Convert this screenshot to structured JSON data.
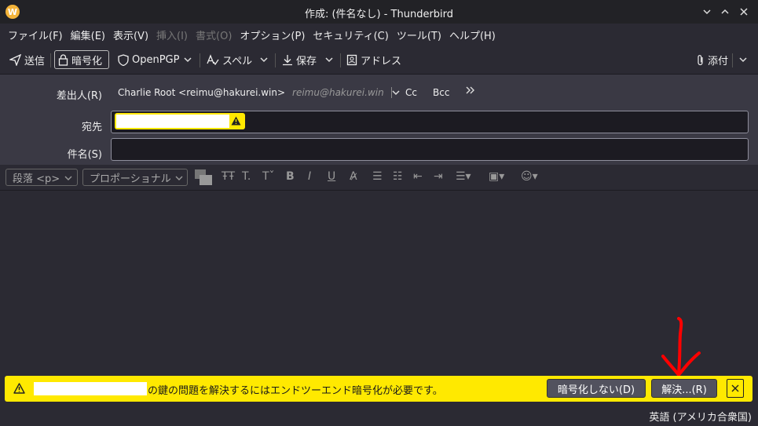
{
  "window": {
    "title": "作成: (件名なし) - Thunderbird",
    "minimize_icon": "chevron-down-icon",
    "maximize_icon": "chevron-up-icon",
    "close_icon": "close-icon"
  },
  "menubar": [
    {
      "label": "ファイル(F)",
      "enabled": true
    },
    {
      "label": "編集(E)",
      "enabled": true
    },
    {
      "label": "表示(V)",
      "enabled": true
    },
    {
      "label": "挿入(I)",
      "enabled": false
    },
    {
      "label": "書式(O)",
      "enabled": false
    },
    {
      "label": "オプション(P)",
      "enabled": true
    },
    {
      "label": "セキュリティ(C)",
      "enabled": true
    },
    {
      "label": "ツール(T)",
      "enabled": true
    },
    {
      "label": "ヘルプ(H)",
      "enabled": true
    }
  ],
  "toolbar": {
    "send": "送信",
    "encrypt": "暗号化",
    "openpgp": "OpenPGP",
    "spell": "スペル",
    "save": "保存",
    "address": "アドレス",
    "attach": "添付"
  },
  "headers": {
    "from_label": "差出人(R)",
    "from_name": "Charlie Root <reimu@hakurei.win>",
    "from_identity": "reimu@hakurei.win",
    "cc": "Cc",
    "bcc": "Bcc",
    "to_label": "宛先",
    "subject_label": "件名(S)",
    "subject_value": ""
  },
  "format_bar": {
    "paragraph": "段落 <p>",
    "font": "プロポーショナル"
  },
  "notification": {
    "message": "の鍵の問題を解決するにはエンドツーエンド暗号化が必要です。",
    "disable_button": "暗号化しない(D)",
    "resolve_button": "解決...(R)"
  },
  "status": {
    "language": "英語 (アメリカ合衆国)"
  },
  "colors": {
    "warning_yellow": "#ffe900",
    "annotation_red": "#ff0000"
  }
}
